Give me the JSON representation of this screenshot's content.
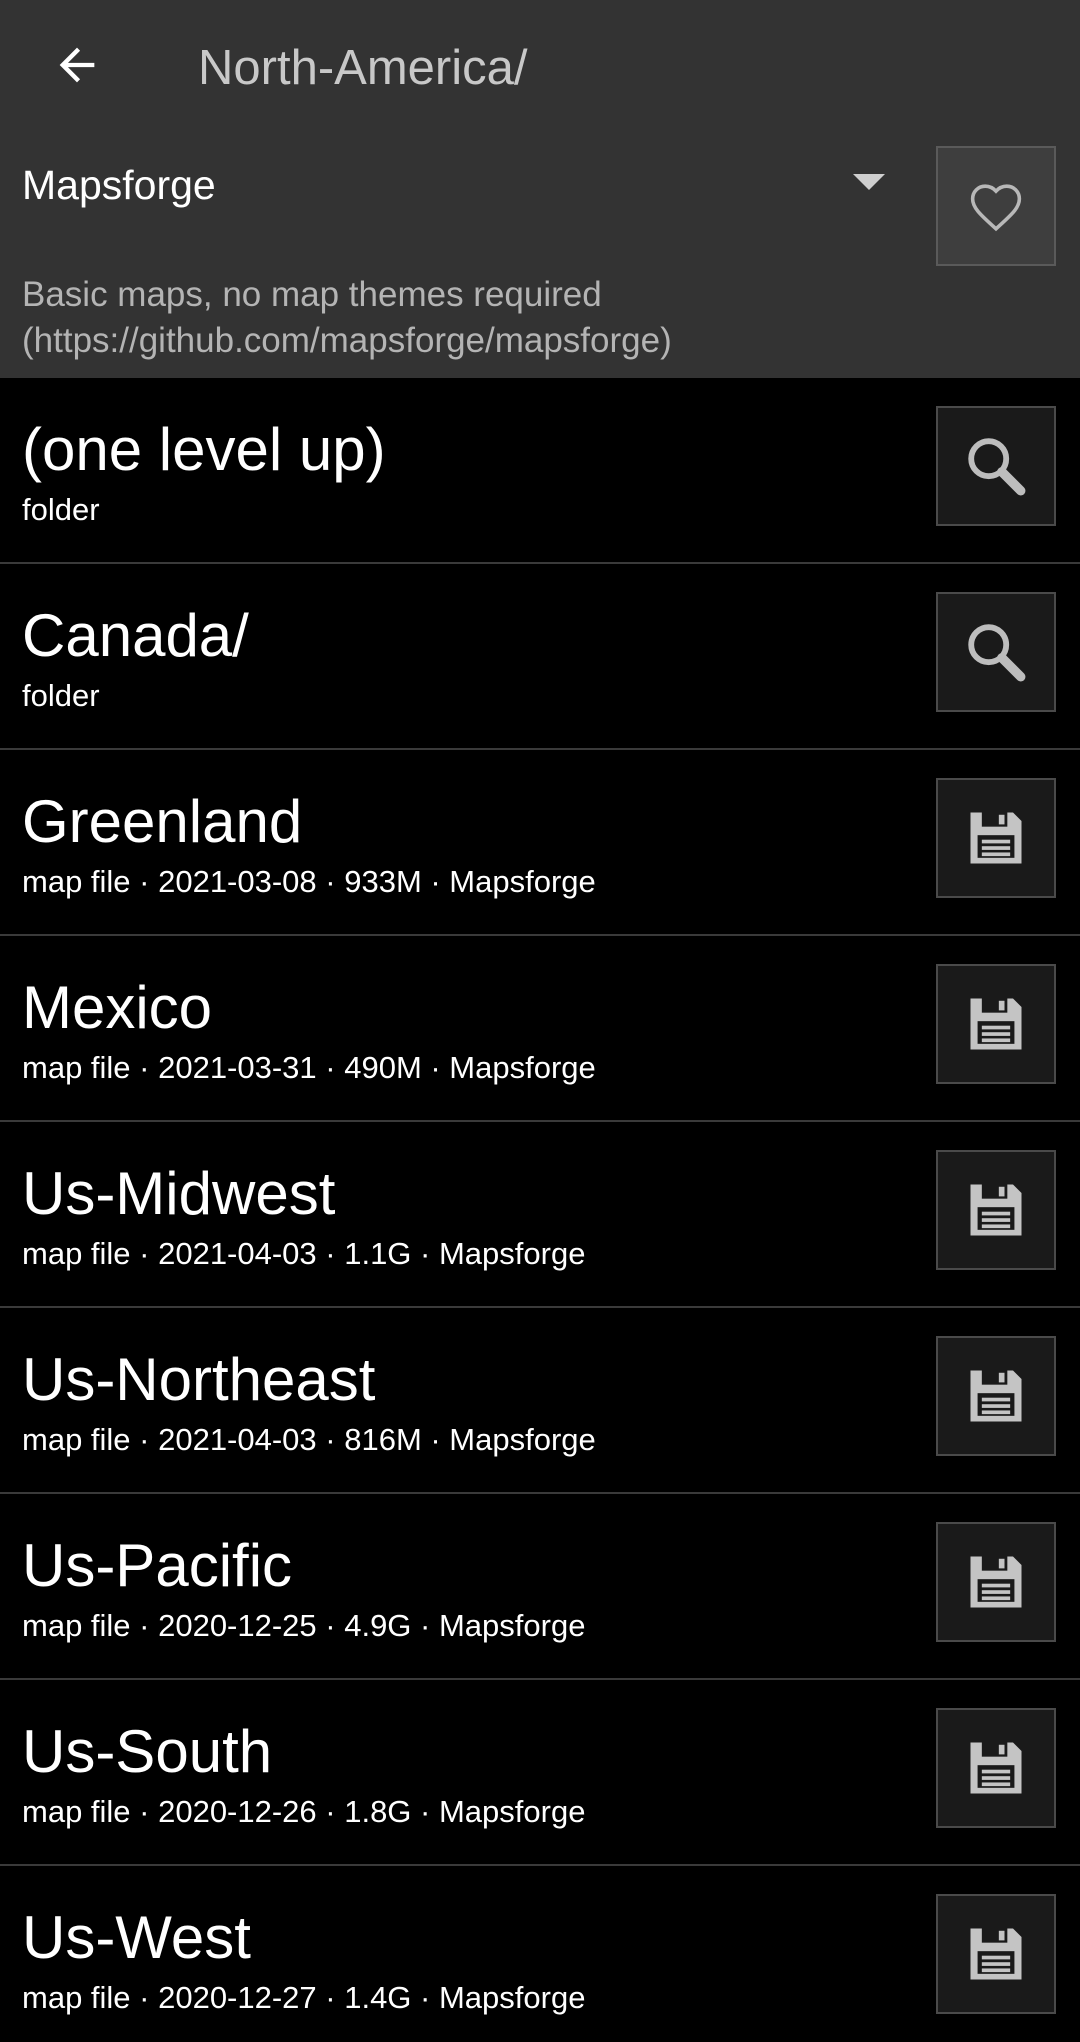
{
  "header": {
    "title": "North-America/",
    "back_icon": "arrow-left-icon"
  },
  "source": {
    "selected": "Mapsforge",
    "description_line1": "Basic maps, no map themes required",
    "description_line2": "(https://github.com/mapsforge/mapsforge)",
    "favorite_icon": "heart-outline-icon"
  },
  "colors": {
    "header_bg": "#333333",
    "list_bg": "#000000",
    "divider": "#3a3a3a",
    "text_primary": "#ffffff",
    "text_secondary": "#b4b4b4"
  },
  "items": [
    {
      "title": "(one level up)",
      "subtitle": "folder",
      "icon": "search-icon"
    },
    {
      "title": "Canada/",
      "subtitle": "folder",
      "icon": "search-icon"
    },
    {
      "title": "Greenland",
      "subtitle": "map file · 2021-03-08 · 933M · Mapsforge",
      "icon": "save-icon"
    },
    {
      "title": "Mexico",
      "subtitle": "map file · 2021-03-31 · 490M · Mapsforge",
      "icon": "save-icon"
    },
    {
      "title": "Us-Midwest",
      "subtitle": "map file · 2021-04-03 · 1.1G · Mapsforge",
      "icon": "save-icon"
    },
    {
      "title": "Us-Northeast",
      "subtitle": "map file · 2021-04-03 · 816M · Mapsforge",
      "icon": "save-icon"
    },
    {
      "title": "Us-Pacific",
      "subtitle": "map file · 2020-12-25 · 4.9G · Mapsforge",
      "icon": "save-icon"
    },
    {
      "title": "Us-South",
      "subtitle": "map file · 2020-12-26 · 1.8G · Mapsforge",
      "icon": "save-icon"
    },
    {
      "title": "Us-West",
      "subtitle": "map file · 2020-12-27 · 1.4G · Mapsforge",
      "icon": "save-icon"
    }
  ]
}
